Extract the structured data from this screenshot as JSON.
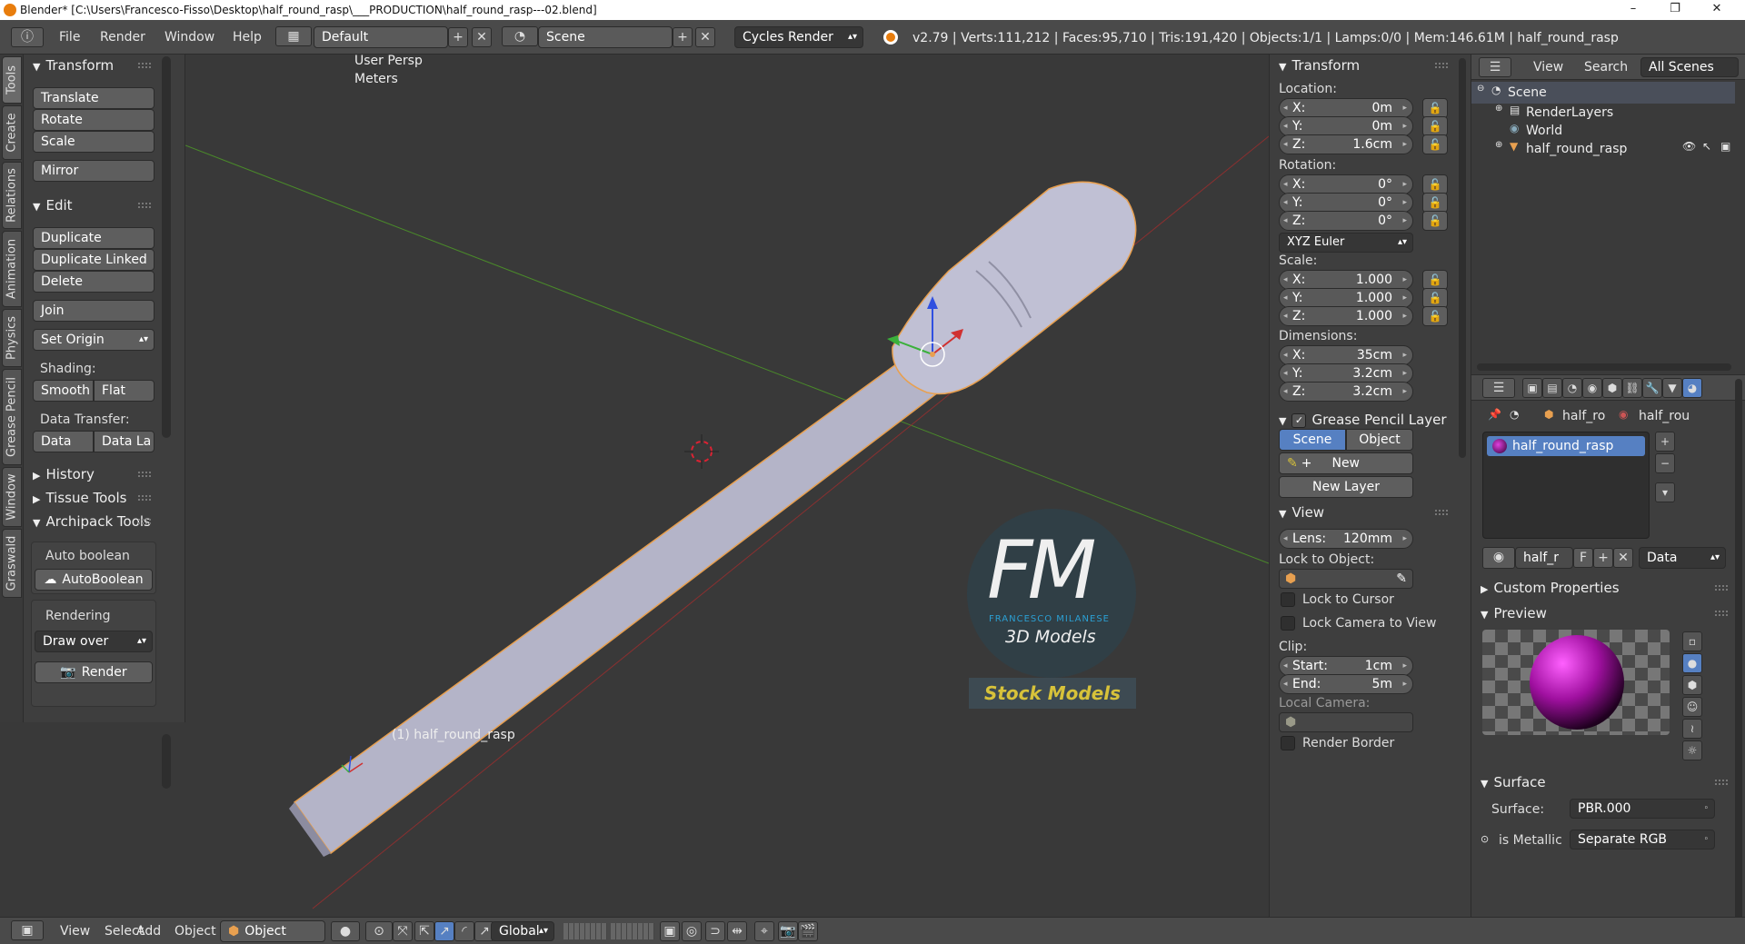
{
  "window": {
    "title": "Blender* [C:\\Users\\Francesco-Fisso\\Desktop\\half_round_rasp\\___PRODUCTION\\half_round_rasp---02.blend]",
    "minimize": "–",
    "maximize": "❐",
    "close": "✕"
  },
  "infobar": {
    "menus": [
      "File",
      "Render",
      "Window",
      "Help"
    ],
    "screen_layout": "Default",
    "scene": "Scene",
    "render_engine": "Cycles Render",
    "stats": "v2.79 | Verts:111,212 | Faces:95,710 | Tris:191,420 | Objects:1/1 | Lamps:0/0 | Mem:146.61M | half_round_rasp"
  },
  "vertical_tabs": [
    "Tools",
    "Create",
    "Relations",
    "Animation",
    "Physics",
    "Grease Pencil",
    "Window",
    "Graswald"
  ],
  "toolshelf": {
    "transform": {
      "title": "Transform",
      "buttons": [
        "Translate",
        "Rotate",
        "Scale",
        "Mirror"
      ]
    },
    "edit": {
      "title": "Edit",
      "buttons": [
        "Duplicate",
        "Duplicate Linked",
        "Delete",
        "Join"
      ],
      "set_origin": "Set Origin",
      "shading_label": "Shading:",
      "smooth": "Smooth",
      "flat": "Flat",
      "data_transfer_label": "Data Transfer:",
      "data": "Data",
      "data_layout": "Data La"
    },
    "history": "History",
    "tissue_tools": "Tissue Tools",
    "archipack": {
      "title": "Archipack Tools",
      "auto_boolean_label": "Auto boolean",
      "auto_boolean_btn": "AutoBoolean",
      "rendering_label": "Rendering",
      "draw_over": "Draw over",
      "render_btn": "Render"
    }
  },
  "viewport": {
    "view_name": "User Persp",
    "units": "Meters",
    "object_label": "(1) half_round_rasp",
    "watermark": {
      "initials": "FM",
      "name": "FRANCESCO MILANESE",
      "tagline": "3D Models",
      "badge": "Stock Models"
    },
    "colors": {
      "background": "#393939",
      "object": "#b4b4c8",
      "selection_outline": "#e8a050",
      "x_axis": "#8a3030",
      "y_axis": "#4a8a2a",
      "watermark_accent": "#2aa8e0",
      "badge_text": "#d7c23a"
    }
  },
  "npanel": {
    "transform_title": "Transform",
    "location_label": "Location:",
    "location": [
      {
        "k": "X:",
        "v": "0m"
      },
      {
        "k": "Y:",
        "v": "0m"
      },
      {
        "k": "Z:",
        "v": "1.6cm"
      }
    ],
    "rotation_label": "Rotation:",
    "rotation": [
      {
        "k": "X:",
        "v": "0°"
      },
      {
        "k": "Y:",
        "v": "0°"
      },
      {
        "k": "Z:",
        "v": "0°"
      }
    ],
    "rotation_mode": "XYZ Euler",
    "scale_label": "Scale:",
    "scale": [
      {
        "k": "X:",
        "v": "1.000"
      },
      {
        "k": "Y:",
        "v": "1.000"
      },
      {
        "k": "Z:",
        "v": "1.000"
      }
    ],
    "dimensions_label": "Dimensions:",
    "dimensions": [
      {
        "k": "X:",
        "v": "35cm"
      },
      {
        "k": "Y:",
        "v": "3.2cm"
      },
      {
        "k": "Z:",
        "v": "3.2cm"
      }
    ],
    "grease_title": "Grease Pencil Layer",
    "scene_btn": "Scene",
    "object_btn": "Object",
    "new_btn": "New",
    "new_layer_btn": "New Layer",
    "view_title": "View",
    "lens": {
      "k": "Lens:",
      "v": "120mm"
    },
    "lock_to_object_label": "Lock to Object:",
    "lock_to_cursor": "Lock to Cursor",
    "lock_camera": "Lock Camera to View",
    "clip_label": "Clip:",
    "clip_start": {
      "k": "Start:",
      "v": "1cm"
    },
    "clip_end": {
      "k": "End:",
      "v": "5m"
    },
    "local_camera_label": "Local Camera:",
    "render_border": "Render Border"
  },
  "outliner": {
    "view": "View",
    "search": "Search",
    "all_scenes": "All Scenes",
    "items": [
      "Scene",
      "RenderLayers",
      "World",
      "half_round_rasp"
    ]
  },
  "properties": {
    "crumb_object": "half_ro",
    "crumb_material": "half_rou",
    "material_slot": "half_round_rasp",
    "material_name": "half_r",
    "fake_user": "F",
    "link": "Data",
    "custom_properties": "Custom Properties",
    "preview": "Preview",
    "surface_title": "Surface",
    "surface_label": "Surface:",
    "surface_value": "PBR.000",
    "is_metallic_label": "is Metallic",
    "is_metallic_value": "Separate RGB"
  },
  "bottombar": {
    "menus": [
      "View",
      "Select",
      "Add",
      "Object"
    ],
    "mode": "Object Mode",
    "orientation": "Global"
  }
}
